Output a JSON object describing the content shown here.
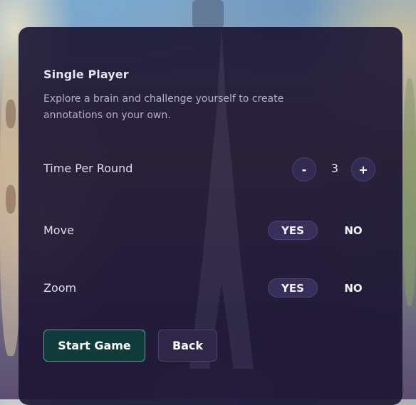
{
  "panel": {
    "title": "Single Player",
    "description": "Explore a brain and challenge yourself to create annotations on your own."
  },
  "settings": {
    "time_per_round": {
      "label": "Time Per Round",
      "decrement_label": "-",
      "value": "3",
      "increment_label": "+"
    },
    "move": {
      "label": "Move",
      "yes_label": "YES",
      "no_label": "NO",
      "selected": "YES"
    },
    "zoom": {
      "label": "Zoom",
      "yes_label": "YES",
      "no_label": "NO",
      "selected": "YES"
    }
  },
  "actions": {
    "start_label": "Start Game",
    "back_label": "Back"
  },
  "colors": {
    "panel_background": "#1b1432",
    "accent_border": "#35b39a",
    "start_button_background": "#0f3b3a",
    "pill_active": "#38305a"
  }
}
